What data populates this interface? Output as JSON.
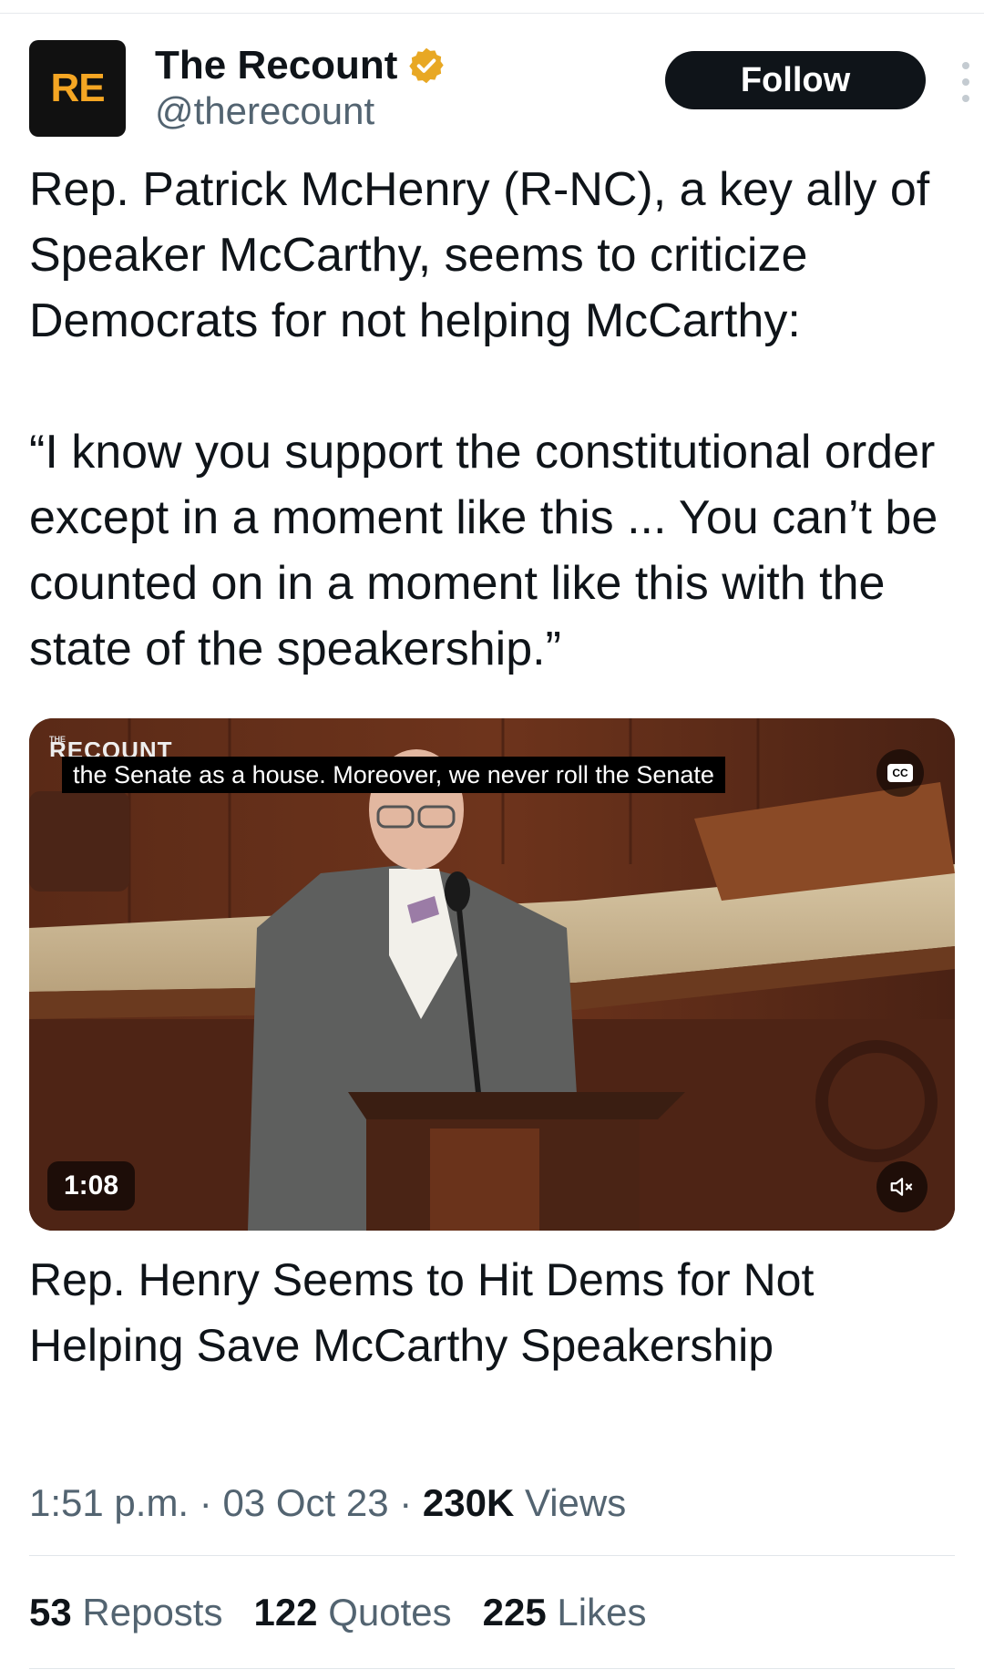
{
  "author": {
    "avatar_text": "RE",
    "display_name": "The Recount",
    "handle": "@therecount",
    "verified_icon": "gold-verified-badge-icon",
    "brand_color": "#f5a623"
  },
  "follow_label": "Follow",
  "tweet_text": "Rep. Patrick McHenry (R-NC), a key ally of Speaker McCarthy, seems to criticize Democrats for not helping McCarthy:\n\n“I know you support the constitutional order except in a moment like this ... You can’t be counted on in a moment like this with the state of the speakership.”",
  "media": {
    "watermark_small": "THE",
    "watermark_logo": "RECOUNT",
    "caption": "the Senate as a house. Moreover, we never roll the Senate",
    "cc_label": "CC",
    "duration": "1:08",
    "mute_icon": "speaker-muted-icon"
  },
  "card_title": "Rep. Henry Seems to Hit Dems for Not Helping Save McCarthy Speakership",
  "meta": {
    "time": "1:51 p.m.",
    "date": "03 Oct 23",
    "views_count": "230K",
    "views_label": "Views"
  },
  "stats": {
    "reposts_count": "53",
    "reposts_label": "Reposts",
    "quotes_count": "122",
    "quotes_label": "Quotes",
    "likes_count": "225",
    "likes_label": "Likes"
  }
}
